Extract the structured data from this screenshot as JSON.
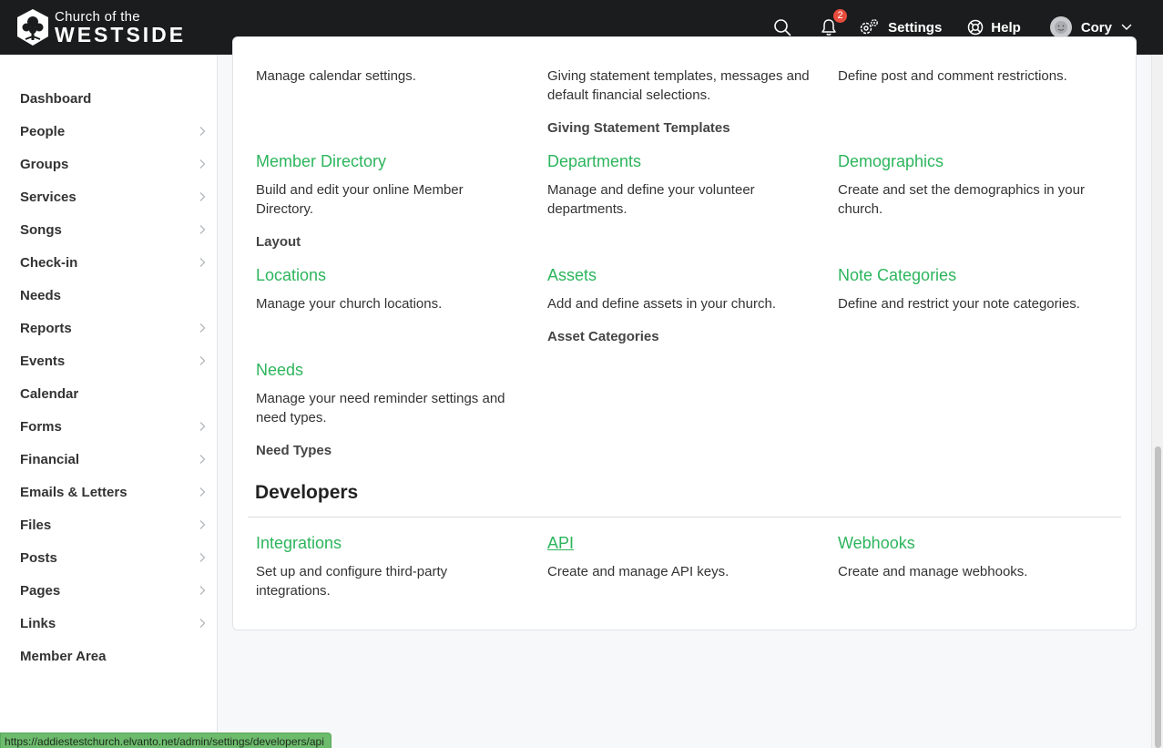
{
  "header": {
    "logo_line1": "Church of the",
    "logo_line2": "WESTSIDE",
    "notifications_count": "2",
    "settings_label": "Settings",
    "help_label": "Help",
    "user_name": "Cory",
    "icons": [
      "search-icon",
      "bell-icon",
      "gear-icon",
      "help-icon",
      "avatar",
      "chevron-down-icon"
    ]
  },
  "sidebar": {
    "items": [
      {
        "label": "Dashboard",
        "has_children": false
      },
      {
        "label": "People",
        "has_children": true
      },
      {
        "label": "Groups",
        "has_children": true
      },
      {
        "label": "Services",
        "has_children": true
      },
      {
        "label": "Songs",
        "has_children": true
      },
      {
        "label": "Check-in",
        "has_children": true
      },
      {
        "label": "Needs",
        "has_children": false
      },
      {
        "label": "Reports",
        "has_children": true
      },
      {
        "label": "Events",
        "has_children": true
      },
      {
        "label": "Calendar",
        "has_children": false
      },
      {
        "label": "Forms",
        "has_children": true
      },
      {
        "label": "Financial",
        "has_children": true
      },
      {
        "label": "Emails & Letters",
        "has_children": true
      },
      {
        "label": "Files",
        "has_children": true
      },
      {
        "label": "Posts",
        "has_children": true
      },
      {
        "label": "Pages",
        "has_children": true
      },
      {
        "label": "Links",
        "has_children": true
      },
      {
        "label": "Member Area",
        "has_children": false
      }
    ]
  },
  "main": {
    "calendar_desc": "Manage calendar settings.",
    "giving_desc": "Giving statement templates, messages and default financial selections.",
    "giving_sub": "Giving Statement Templates",
    "posts_desc": "Define post and comment restrictions.",
    "member_directory": {
      "title": "Member Directory",
      "desc": "Build and edit your online Member Directory.",
      "sub": "Layout"
    },
    "departments": {
      "title": "Departments",
      "desc": "Manage and define your volunteer departments."
    },
    "demographics": {
      "title": "Demographics",
      "desc": "Create and set the demographics in your church."
    },
    "locations": {
      "title": "Locations",
      "desc": "Manage your church locations."
    },
    "assets": {
      "title": "Assets",
      "desc": "Add and define assets in your church.",
      "sub": "Asset Categories"
    },
    "note_categories": {
      "title": "Note Categories",
      "desc": "Define and restrict your note categories."
    },
    "needs": {
      "title": "Needs",
      "desc": "Manage your need reminder settings and need types.",
      "sub": "Need Types"
    },
    "developers_heading": "Developers",
    "integrations": {
      "title": "Integrations",
      "desc": "Set up and configure third-party integrations."
    },
    "api": {
      "title": "API",
      "desc": "Create and manage API keys."
    },
    "webhooks": {
      "title": "Webhooks",
      "desc": "Create and manage webhooks."
    }
  },
  "status_url": "https://addiestestchurch.elvanto.net/admin/settings/developers/api",
  "colors": {
    "accent": "#2db55d",
    "topbar": "#1b1c1d",
    "badge": "#e74c3c"
  }
}
